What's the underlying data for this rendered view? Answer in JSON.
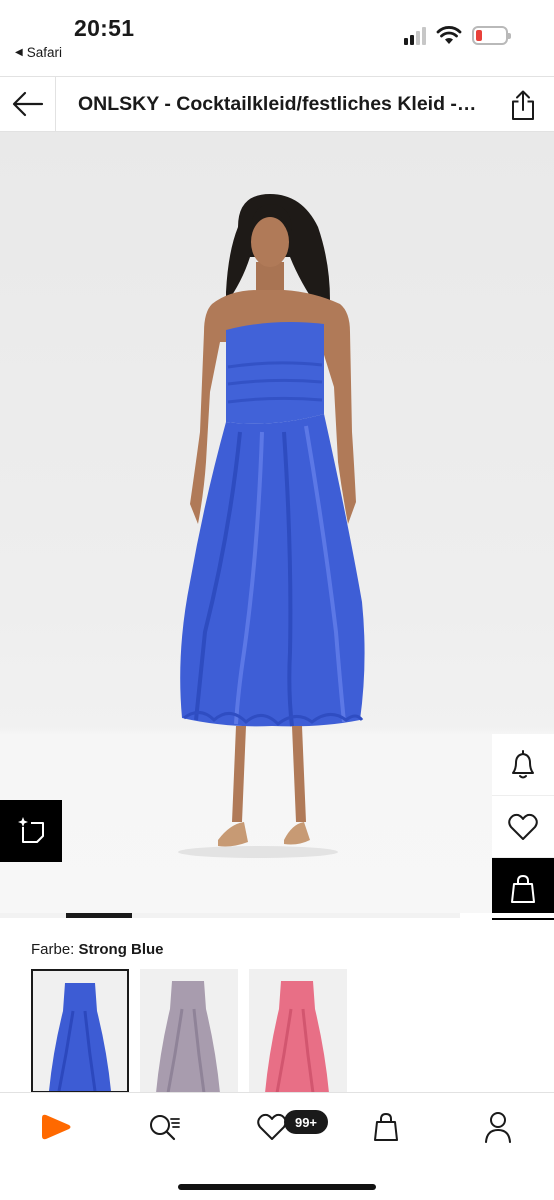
{
  "status_bar": {
    "time": "20:51",
    "back_app": "Safari",
    "signal_bars_active": 2,
    "battery_level_percent": 10,
    "battery_color": "#e8403a"
  },
  "header": {
    "title": "ONLSKY - Cocktailkleid/festliches Kleid - strong blue"
  },
  "product": {
    "dress_color": "#3e5ed6",
    "gallery_active_index": 1
  },
  "color_section": {
    "label": "Farbe:",
    "selected_color": "Strong Blue",
    "swatches": [
      {
        "name": "strong-blue",
        "color": "#3d5cd4",
        "selected": true
      },
      {
        "name": "lilac-grey",
        "color": "#a89cae",
        "selected": false
      },
      {
        "name": "pink",
        "color": "#e86f86",
        "selected": false
      }
    ]
  },
  "bottom_nav": {
    "items": [
      "home",
      "search",
      "wishlist",
      "bag",
      "profile"
    ],
    "wishlist_badge": "99+",
    "brand_color": "#ff6900"
  }
}
